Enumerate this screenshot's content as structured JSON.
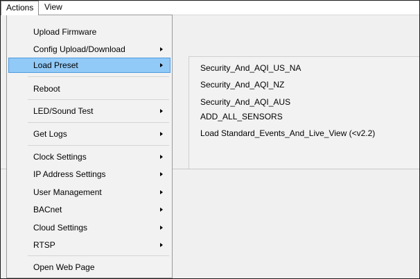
{
  "menubar": {
    "actions_label": "Actions",
    "view_label": "View"
  },
  "actions_menu": {
    "items": [
      {
        "label": "Upload Firmware"
      },
      {
        "label": "Config Upload/Download"
      },
      {
        "label": "Load Preset"
      },
      {
        "label": "Reboot"
      },
      {
        "label": "LED/Sound Test"
      },
      {
        "label": "Get Logs"
      },
      {
        "label": "Clock Settings"
      },
      {
        "label": "IP Address Settings"
      },
      {
        "label": "User Management"
      },
      {
        "label": "BACnet"
      },
      {
        "label": "Cloud Settings"
      },
      {
        "label": "RTSP"
      },
      {
        "label": "Open Web Page"
      }
    ],
    "highlighted": "Load Preset"
  },
  "load_preset_submenu": {
    "items": [
      {
        "label": "Security_And_AQI_US_NA"
      },
      {
        "label": "Security_And_AQI_NZ"
      },
      {
        "label": "Security_And_AQI_AUS"
      },
      {
        "label": "ADD_ALL_SENSORS"
      },
      {
        "label": "Load Standard_Events_And_Live_View (<v2.2)"
      }
    ]
  },
  "icons": {
    "submenu_arrow": "chevron-right-icon"
  }
}
